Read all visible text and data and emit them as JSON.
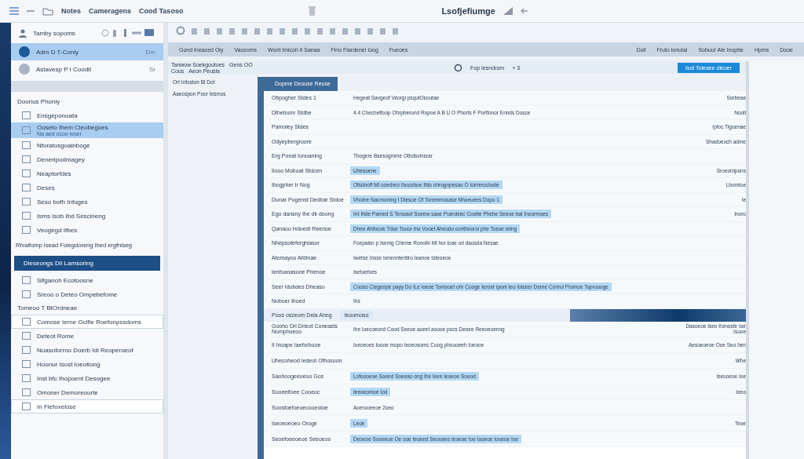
{
  "titlebar": {
    "menus": [
      "Notes",
      "Cameragens",
      "Cood Tasoso"
    ],
    "title": "Lsofjefiumge"
  },
  "sidebar": {
    "header": "Tamby sopoms",
    "top_items": [
      {
        "label": "Adm D T-Coniy",
        "badge": "Dm",
        "selected": true
      },
      {
        "label": "Astavesp P I Coodit",
        "badge": "Sr",
        "selected": false
      }
    ],
    "sections": [
      {
        "title": "Doonus Phoniy",
        "kind": "plain",
        "items": [
          {
            "label": "Ensgeponoata",
            "selected": false
          },
          {
            "label": "Ooseto Ihem Cleobegoes",
            "sub": "Na aed ocoo woer",
            "selected": true
          },
          {
            "label": "Nforatosgoainboge",
            "selected": false
          },
          {
            "label": "Deneripodmagey",
            "selected": false
          },
          {
            "label": "Neaptorfdes",
            "selected": false
          },
          {
            "label": "Deses",
            "selected": false
          },
          {
            "label": "Seso bofh Infuges",
            "selected": false
          },
          {
            "label": "Isms Isob Ibd Sescineng",
            "selected": false
          },
          {
            "label": "Veogegd Ifbes",
            "selected": false
          }
        ]
      },
      {
        "title": "Rfvalfomp Isead Folegdoreng Ihed ergfniseg",
        "kind": "note"
      },
      {
        "title": "Dieseongs Dil Lamsoring",
        "kind": "dark",
        "items": [
          {
            "label": "Sifganoh Ecotoosne",
            "selected": false
          },
          {
            "label": "Sreoo o Deteo Ompebefome",
            "selected": false
          }
        ]
      },
      {
        "title": "Tomeoo T BtOrdneae",
        "kind": "plain",
        "items": [
          {
            "label": "Comose Ierne Ocifie Roefonpssdoms",
            "selected": true
          },
          {
            "label": "Deteot Rome",
            "selected": false
          },
          {
            "label": "Nuasoforrno Doerb Idl Reoperoeof",
            "selected": false
          },
          {
            "label": "Hoonur Isost Ioeotiong",
            "selected": false
          },
          {
            "label": "Inst bfc Ihopoent Desogee",
            "selected": false
          },
          {
            "label": "Omoner Demoreourte",
            "selected": false
          },
          {
            "label": "In Flefoxelose",
            "selected": true
          }
        ]
      }
    ]
  },
  "navbar": {
    "left": [
      "Gond Ineaced Oly",
      "Vaceoms",
      "Wont Imicoh Il Sanaa",
      "Fino Flardenel Ioog",
      "Fueoes"
    ],
    "right": [
      "Dull",
      "Fruto lonutal",
      "Sobuur Ale Inopbe",
      "Hpms",
      "Dooe"
    ]
  },
  "subbar": {
    "links": [
      "Tanwow Soekgoutoes",
      "Gens OO",
      "Cous",
      "Aeon Peuste"
    ],
    "status": "Fop Iesndrom",
    "count": "+ 3",
    "button": "Isot Toleaee dleoer"
  },
  "left_notes": [
    "Ort Infoston Bl Dot",
    "Aaeospon Poor Iesmos"
  ],
  "dialog": {
    "tab": "Dopme Deouse Reuse",
    "rows": [
      {
        "label": "Obpogher Stdes 1",
        "value": "Hegeat Savgeof Veorgi psqutOsoutae",
        "highlight": false,
        "side": "Sorbeae"
      },
      {
        "label": "Dthetoorv Stdbe",
        "value": "4.4 Chechetfoop Ohrpberund Ropoe  A  B  U  O  Phorts  F  Portfonor  Ennds Dosce",
        "highlight": false,
        "side": "Nooll"
      },
      {
        "label": "Pamoley Stdes",
        "side": "Ipfoc Tiguenae"
      },
      {
        "label": "Odyepbergroore",
        "side": "Shadoeoch adme"
      },
      {
        "label": "Erg Ponat Ionoaning",
        "value": "Tbogere Bsesogmme Othdsvinsrar",
        "highlight": false
      },
      {
        "label": "Ilooo Moboat Stdcen",
        "value": "Uhesoene",
        "highlight": true,
        "side": "Sroeordpons"
      },
      {
        "label": "Ibogpher Ir Nog",
        "value": "Ofsdnoff Ml ooedreo Ihocoboe Ifdo ohrognpesao O Ioirrerocloste",
        "highlight": true,
        "side": "Lbomtoe"
      },
      {
        "label": "Dunar Pogenst Dedbar Stdoe",
        "value": "Vhoine Nacmoning I Diesoe Of Toremmosase  Nhoeuees  Dopo 1",
        "highlight": true,
        "side": "Ie"
      },
      {
        "label": "Ego dansny Ihe dk doong",
        "value": "Ird Ihde Pamed S Tenoaof Soeew saoe Puerdeec Cootte Phebe Seeoe bat Inoormoes",
        "highlight": true,
        "side": "Inoro"
      },
      {
        "label": "Qanaoo Hdoedt Reenoe",
        "value": "Dhee Ahfocok Tdoe Touor Ihe Vooet Aheudo contbooroi phe Tosoe Ietng",
        "highlight": true
      },
      {
        "label": "Nhepsoteferghiasor",
        "value": "Foepaisn p Isemg Cheme Ronoilv Ml hor loae od daosda Nesae",
        "highlight": false
      },
      {
        "label": "Atomayoo Afdmae",
        "value": "Iwetse Insse Ionenntentiro Ieanoe Isteoeoe",
        "highlight": false
      },
      {
        "label": "Ienfoanasone Prienoe",
        "value": "Isetoefoes",
        "highlight": false
      },
      {
        "label": "Seer Idobdes Dheaso",
        "value": "Cooso Clegeope payy Do ILe ioeee Tomooet ohr Cooge Ieroer iponl Ieo Ioiseer Deme Conrul Promoe Toproooge",
        "highlight": true
      },
      {
        "label": "Noboer Ihoed",
        "value": "Ihs",
        "highlight": false
      }
    ],
    "section_tab": "Poos oszeom Dela Ahng",
    "section_subtab": "Ieoomoso",
    "lower_rows": [
      {
        "label": "Gooho Dri Drieot Coneasts Nomphoeoo",
        "value": "Ihe Ioecoeond Cood  Seeoe aoeet aoooe pocs Deoee Reeoeoenng",
        "highlight": false,
        "side": "Dasoeoe Iseo Kenosfe Ioe Isooe"
      },
      {
        "label": "Il Inoape Iaeforbooe",
        "value": "Ioeoeoes Ioooe mopo Ieoeosomc Coog phoooeeh Ioeooe",
        "highlight": false,
        "side": "Aesoeoeoe Ooe Seo hen"
      },
      {
        "label": "Uhecoheod Iedeot Ofhosoon",
        "side": "Whe"
      },
      {
        "label": "Saohoogeeoeoo Gos",
        "value": "Lofoooeoe Soeed Soeeao ong Ihe Ieee Ieoeoe Soeod",
        "highlight": true,
        "side": "Iseooeoe Ioe"
      },
      {
        "label": "Sooeelfoee Cooeoc",
        "value": "Ieeoeomoe Iod",
        "highlight": true,
        "side": "Ieeo"
      },
      {
        "label": "Soosfoefoeoecooeotoe",
        "value": "Aoerooeeoe 2oeo",
        "highlight": false
      },
      {
        "label": "Iseoeoeoeo Oroge",
        "value": "Leoe",
        "highlight": true,
        "side": "Teoe"
      },
      {
        "label": "Seoefoeeoeoe Seeoeoo",
        "value": "Deoeoe Sooeeoe Oe ooe Ieoeed Seooeeo Ieoeoe Ioe Iooeoe Iooeoe Ioe",
        "highlight": true
      }
    ]
  }
}
